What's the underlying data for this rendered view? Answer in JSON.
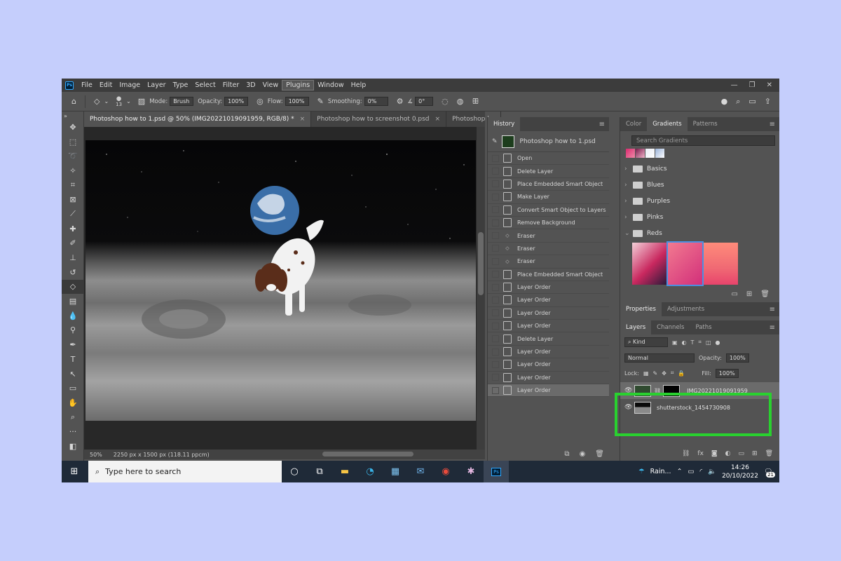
{
  "menubar": {
    "logo": "Ps",
    "items": [
      "File",
      "Edit",
      "Image",
      "Layer",
      "Type",
      "Select",
      "Filter",
      "3D",
      "View",
      "Plugins",
      "Window",
      "Help"
    ],
    "active_item": "Plugins",
    "window_controls": [
      "—",
      "❐",
      "✕"
    ]
  },
  "options": {
    "brush_size": "13",
    "mode_label": "Mode:",
    "mode_value": "Brush",
    "opacity_label": "Opacity:",
    "opacity_value": "100%",
    "flow_label": "Flow:",
    "flow_value": "100%",
    "smoothing_label": "Smoothing:",
    "smoothing_value": "0%",
    "angle_value": "0°"
  },
  "doc_tabs": [
    {
      "label": "Photoshop how to 1.psd @ 50% (IMG20221019091959, RGB/8) *",
      "close": "×"
    },
    {
      "label": "Photoshop how to screenshot 0.psd",
      "close": "×"
    },
    {
      "label": "Photoshop ho",
      "close": ""
    }
  ],
  "status": {
    "zoom": "50%",
    "doc_size": "2250 px x 1500 px (118.11 ppcm)"
  },
  "history": {
    "tab": "History",
    "snapshot": "Photoshop how to 1.psd",
    "rows": [
      {
        "label": "Open",
        "icon": "doc"
      },
      {
        "label": "Delete Layer",
        "icon": "doc"
      },
      {
        "label": "Place Embedded Smart Object",
        "icon": "doc"
      },
      {
        "label": "Make Layer",
        "icon": "doc"
      },
      {
        "label": "Convert Smart Object to Layers",
        "icon": "doc"
      },
      {
        "label": "Remove Background",
        "icon": "doc"
      },
      {
        "label": "Eraser",
        "icon": "eraser"
      },
      {
        "label": "Eraser",
        "icon": "eraser"
      },
      {
        "label": "Eraser",
        "icon": "eraser"
      },
      {
        "label": "Place Embedded Smart Object",
        "icon": "doc"
      },
      {
        "label": "Layer Order",
        "icon": "doc"
      },
      {
        "label": "Layer Order",
        "icon": "doc"
      },
      {
        "label": "Layer Order",
        "icon": "doc"
      },
      {
        "label": "Layer Order",
        "icon": "doc"
      },
      {
        "label": "Delete Layer",
        "icon": "doc"
      },
      {
        "label": "Layer Order",
        "icon": "doc"
      },
      {
        "label": "Layer Order",
        "icon": "doc"
      },
      {
        "label": "Layer Order",
        "icon": "doc"
      },
      {
        "label": "Layer Order",
        "icon": "doc"
      }
    ],
    "selected_index": 18
  },
  "gradients_panel": {
    "tabs": [
      "Color",
      "Gradients",
      "Patterns"
    ],
    "active_tab": "Gradients",
    "search_placeholder": "Search Gradients",
    "folders": [
      "Basics",
      "Blues",
      "Purples",
      "Pinks",
      "Reds"
    ],
    "open_folder": "Reds"
  },
  "properties_panel": {
    "tabs": [
      "Properties",
      "Adjustments"
    ],
    "active_tab": "Properties"
  },
  "layers_panel": {
    "tabs": [
      "Layers",
      "Channels",
      "Paths"
    ],
    "active_tab": "Layers",
    "filter_label": "Kind",
    "blend_mode": "Normal",
    "opacity_label": "Opacity:",
    "opacity_value": "100%",
    "lock_label": "Lock:",
    "fill_label": "Fill:",
    "fill_value": "100%",
    "layers": [
      {
        "name": "IMG20221019091959",
        "selected": true
      },
      {
        "name": "shutterstock_1454730908",
        "selected": false
      }
    ]
  },
  "taskbar": {
    "search_placeholder": "Type here to search",
    "weather": "Rain...",
    "time": "14:26",
    "date": "20/10/2022",
    "notifications": "21"
  },
  "colors": {
    "ui_bg": "#535353",
    "highlight_box": "#29d12f",
    "selection": "#6b6b6b"
  }
}
